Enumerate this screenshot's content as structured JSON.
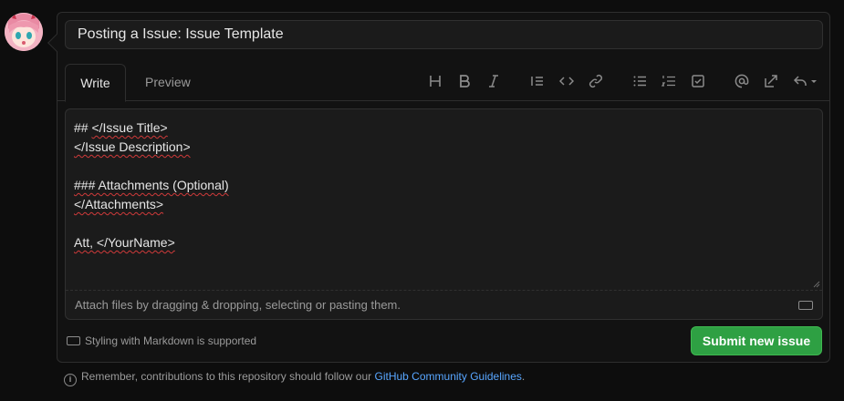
{
  "avatar": {
    "alt_icon": "anime-avatar"
  },
  "title": {
    "value": "Posting a Issue: Issue Template"
  },
  "tabs": [
    {
      "label": "Write",
      "active": true
    },
    {
      "label": "Preview",
      "active": false
    }
  ],
  "toolbar": [
    "heading-icon",
    "bold-icon",
    "italic-icon",
    "quote-icon",
    "code-icon",
    "link-icon",
    "unordered-list-icon",
    "ordered-list-icon",
    "task-list-icon",
    "mention-icon",
    "reference-icon",
    "reply-icon"
  ],
  "editor": {
    "lines": [
      [
        "## ",
        "</Issue Title>"
      ],
      [
        "</Issue Description>"
      ],
      [
        ""
      ],
      [
        "### Attachments (Optional)"
      ],
      [
        "</Attachments>"
      ],
      [
        ""
      ],
      [
        "Att, </YourName>"
      ]
    ],
    "attach_hint": "Attach files by dragging & dropping, selecting or pasting them."
  },
  "markdown_note": "Styling with Markdown is supported",
  "submit_label": "Submit new issue",
  "footer": {
    "text": "Remember, contributions to this repository should follow our ",
    "link": "GitHub Community Guidelines",
    "end": "."
  },
  "colors": {
    "accent_green": "#2ea043",
    "link_blue": "#58a6ff",
    "background": "#0d0d0d"
  }
}
